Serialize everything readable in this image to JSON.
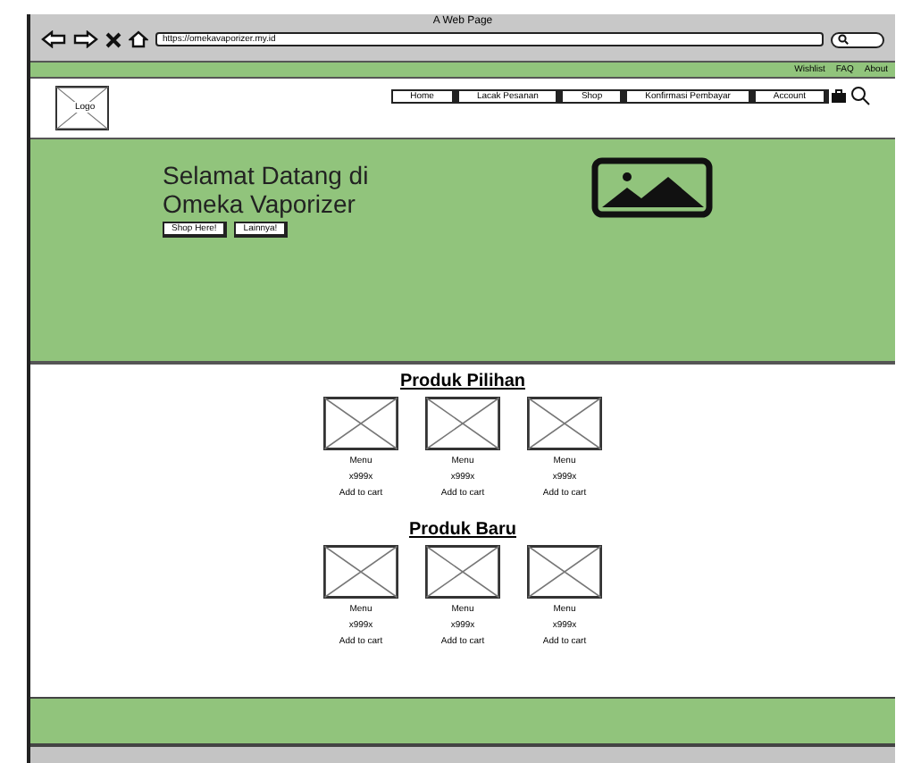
{
  "window": {
    "title": "A Web Page",
    "url": "https://omekavaporizer.my.id"
  },
  "top_links": [
    "Wishlist",
    "FAQ",
    "About"
  ],
  "header": {
    "logo": "Logo",
    "nav": [
      "Home",
      "Lacak Pesanan",
      "Shop",
      "Konfirmasi Pembayar",
      "Account"
    ]
  },
  "hero": {
    "title": "Selamat Datang di Omeka Vaporizer",
    "buttons": [
      "Shop Here!",
      "Lainnya!"
    ]
  },
  "sections": [
    {
      "title": "Produk Pilihan",
      "products": [
        {
          "name": "Menu",
          "price": "x999x",
          "action": "Add to cart"
        },
        {
          "name": "Menu",
          "price": "x999x",
          "action": "Add to cart"
        },
        {
          "name": "Menu",
          "price": "x999x",
          "action": "Add to cart"
        }
      ]
    },
    {
      "title": "Produk Baru",
      "products": [
        {
          "name": "Menu",
          "price": "x999x",
          "action": "Add to cart"
        },
        {
          "name": "Menu",
          "price": "x999x",
          "action": "Add to cart"
        },
        {
          "name": "Menu",
          "price": "x999x",
          "action": "Add to cart"
        }
      ]
    }
  ]
}
